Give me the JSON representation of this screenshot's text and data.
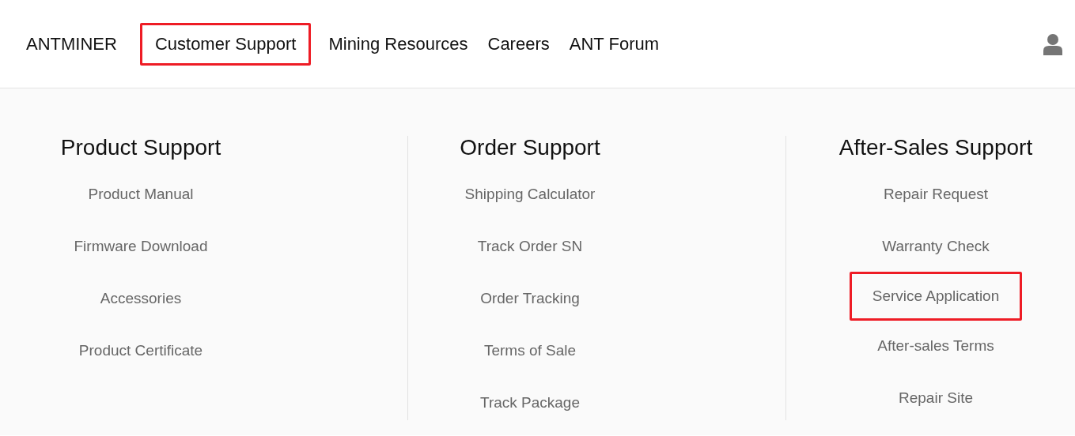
{
  "nav": {
    "items": [
      {
        "label": "ANTMINER",
        "highlighted": false
      },
      {
        "label": "Customer Support",
        "highlighted": true
      },
      {
        "label": "Mining Resources",
        "highlighted": false
      },
      {
        "label": "Careers",
        "highlighted": false
      },
      {
        "label": "ANT Forum",
        "highlighted": false
      }
    ]
  },
  "menu": {
    "columns": [
      {
        "heading": "Product Support",
        "links": [
          {
            "label": "Product Manual",
            "highlighted": false
          },
          {
            "label": "Firmware Download",
            "highlighted": false
          },
          {
            "label": "Accessories",
            "highlighted": false
          },
          {
            "label": "Product Certificate",
            "highlighted": false
          }
        ]
      },
      {
        "heading": "Order Support",
        "links": [
          {
            "label": "Shipping Calculator",
            "highlighted": false
          },
          {
            "label": "Track Order SN",
            "highlighted": false
          },
          {
            "label": "Order Tracking",
            "highlighted": false
          },
          {
            "label": "Terms of Sale",
            "highlighted": false
          },
          {
            "label": "Track Package",
            "highlighted": false
          }
        ]
      },
      {
        "heading": "After-Sales Support",
        "links": [
          {
            "label": "Repair Request",
            "highlighted": false
          },
          {
            "label": "Warranty Check",
            "highlighted": false
          },
          {
            "label": "Service Application",
            "highlighted": true
          },
          {
            "label": "After-sales Terms",
            "highlighted": false
          },
          {
            "label": "Repair Site",
            "highlighted": false
          }
        ]
      }
    ]
  }
}
